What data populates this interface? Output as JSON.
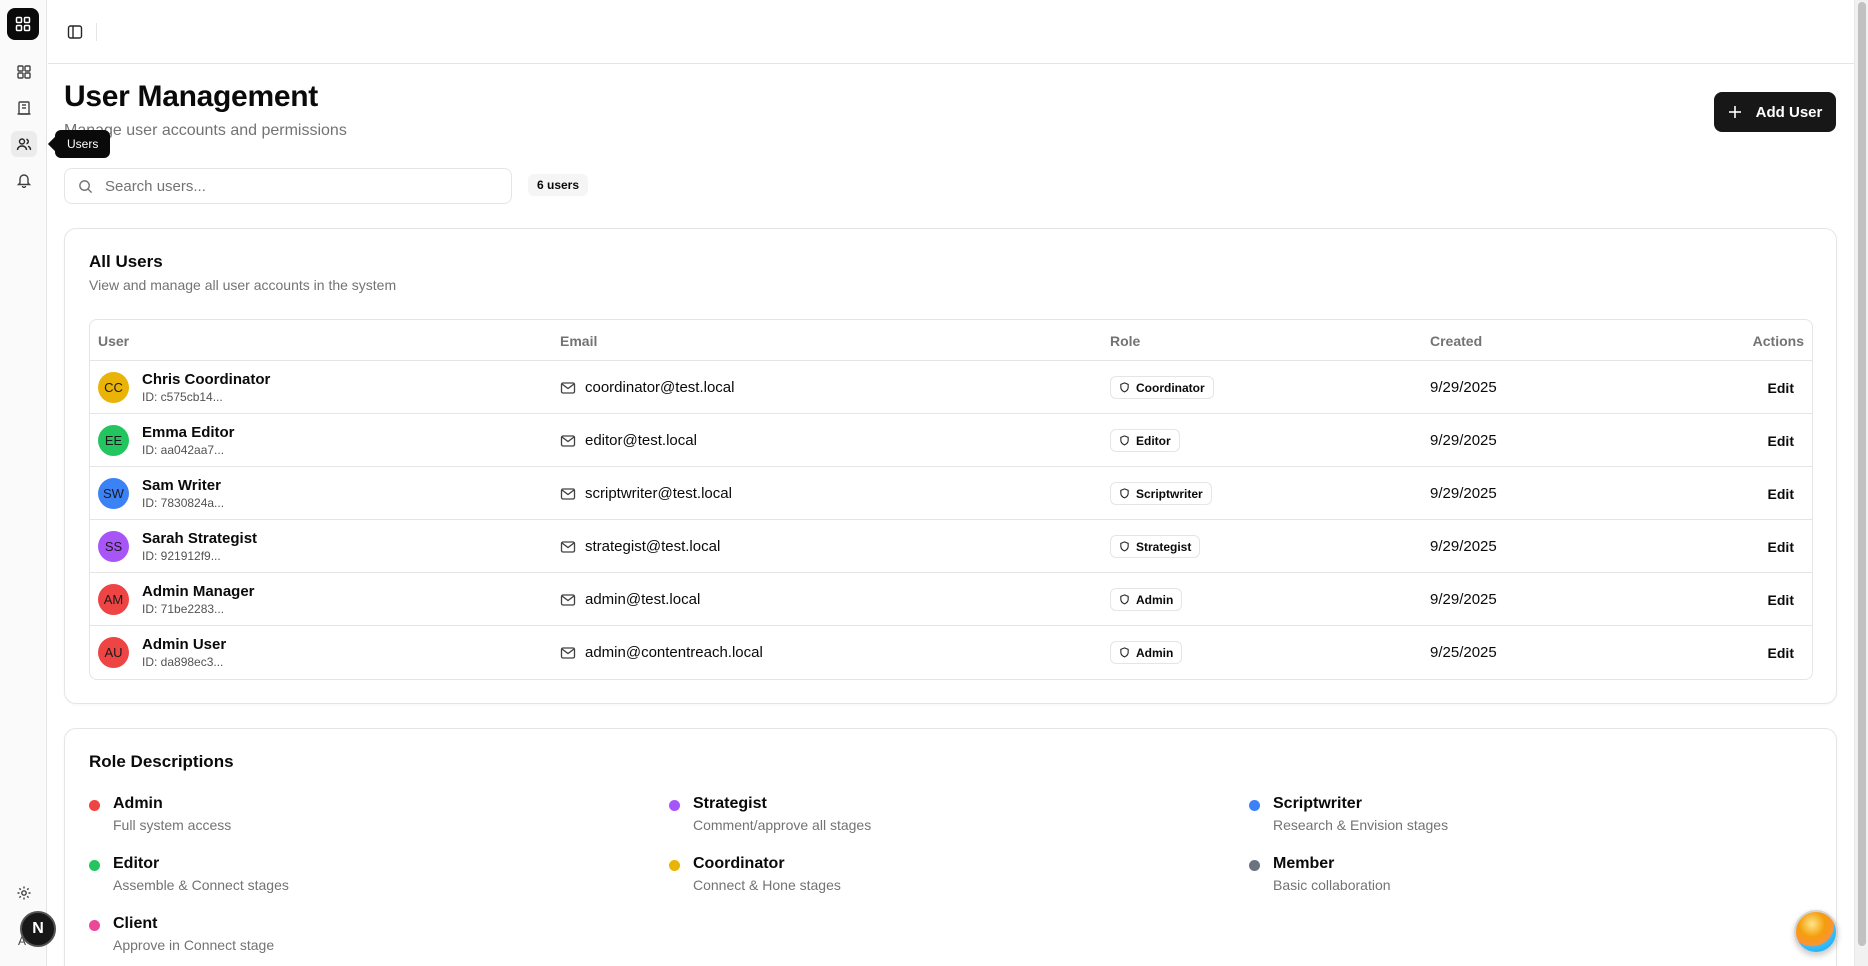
{
  "sidebar": {
    "tooltip": "Users",
    "avatar_initial": "N",
    "avatar_under": "A"
  },
  "header": {
    "title": "User Management",
    "subtitle": "Manage user accounts and permissions",
    "add_user_label": "Add User"
  },
  "search": {
    "placeholder": "Search users...",
    "value": "",
    "count_label": "6 users"
  },
  "users_card": {
    "title": "All Users",
    "description": "View and manage all user accounts in the system",
    "columns": [
      "User",
      "Email",
      "Role",
      "Created",
      "Actions"
    ],
    "rows": [
      {
        "initials": "CC",
        "name": "Chris Coordinator",
        "id": "ID: c575cb14...",
        "email": "coordinator@test.local",
        "role": "Coordinator",
        "created": "9/29/2025",
        "action": "Edit",
        "color": "#eab308"
      },
      {
        "initials": "EE",
        "name": "Emma Editor",
        "id": "ID: aa042aa7...",
        "email": "editor@test.local",
        "role": "Editor",
        "created": "9/29/2025",
        "action": "Edit",
        "color": "#22c55e"
      },
      {
        "initials": "SW",
        "name": "Sam Writer",
        "id": "ID: 7830824a...",
        "email": "scriptwriter@test.local",
        "role": "Scriptwriter",
        "created": "9/29/2025",
        "action": "Edit",
        "color": "#3b82f6"
      },
      {
        "initials": "SS",
        "name": "Sarah Strategist",
        "id": "ID: 921912f9...",
        "email": "strategist@test.local",
        "role": "Strategist",
        "created": "9/29/2025",
        "action": "Edit",
        "color": "#a855f7"
      },
      {
        "initials": "AM",
        "name": "Admin Manager",
        "id": "ID: 71be2283...",
        "email": "admin@test.local",
        "role": "Admin",
        "created": "9/29/2025",
        "action": "Edit",
        "color": "#ef4444"
      },
      {
        "initials": "AU",
        "name": "Admin User",
        "id": "ID: da898ec3...",
        "email": "admin@contentreach.local",
        "role": "Admin",
        "created": "9/25/2025",
        "action": "Edit",
        "color": "#ef4444"
      }
    ]
  },
  "roles_card": {
    "title": "Role Descriptions",
    "roles": [
      {
        "name": "Admin",
        "desc": "Full system access",
        "color": "#ef4444"
      },
      {
        "name": "Strategist",
        "desc": "Comment/approve all stages",
        "color": "#a855f7"
      },
      {
        "name": "Scriptwriter",
        "desc": "Research & Envision stages",
        "color": "#3b82f6"
      },
      {
        "name": "Editor",
        "desc": "Assemble & Connect stages",
        "color": "#22c55e"
      },
      {
        "name": "Coordinator",
        "desc": "Connect & Hone stages",
        "color": "#eab308"
      },
      {
        "name": "Member",
        "desc": "Basic collaboration",
        "color": "#6b7280"
      },
      {
        "name": "Client",
        "desc": "Approve in Connect stage",
        "color": "#ec4899"
      }
    ]
  }
}
